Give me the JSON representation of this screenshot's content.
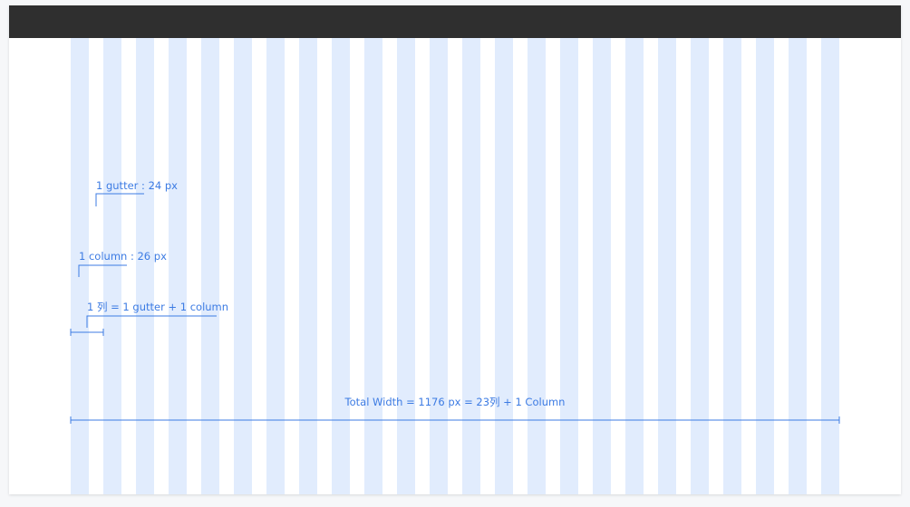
{
  "colors": {
    "topbar": "#2f2f2f",
    "column_fill": "#e1ecfd",
    "annotation": "#3c7be3",
    "canvas": "#ffffff"
  },
  "grid": {
    "column_count": 24
  },
  "annotations": {
    "gutter_label": "1 gutter : 24 px",
    "column_label": "1 column : 26 px",
    "unit_label": "1 列 = 1 gutter + 1 column",
    "total_label": "Total Width = 1176 px = 23列 + 1 Column"
  }
}
